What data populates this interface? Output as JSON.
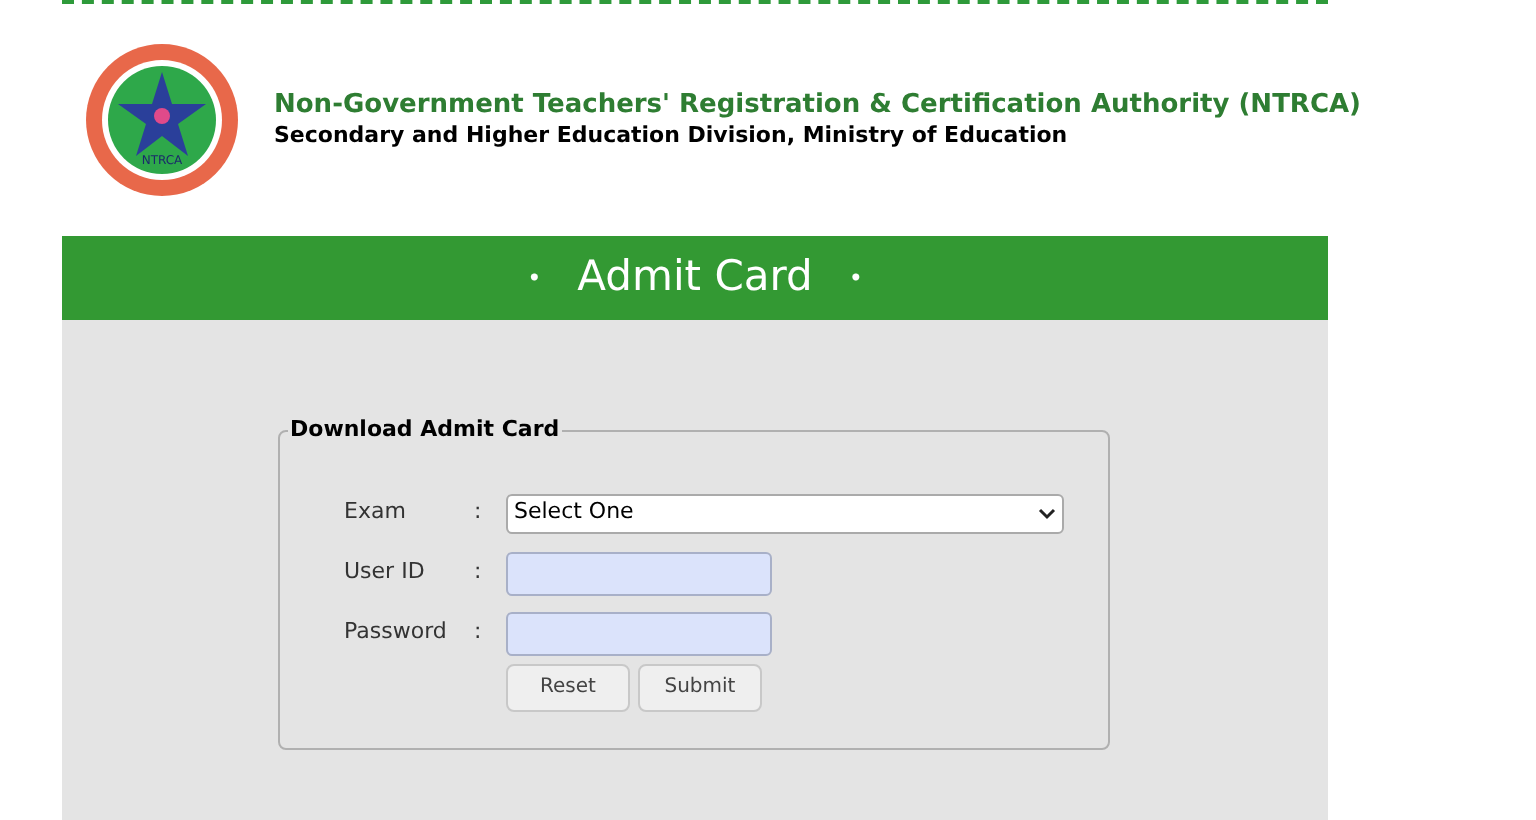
{
  "header": {
    "logo_text": "NTRCA",
    "title": "Non-Government Teachers' Registration & Certification Authority (NTRCA)",
    "subtitle": "Secondary and Higher Education Division, Ministry of Education"
  },
  "banner": {
    "bullet_left": "•",
    "title": "Admit Card",
    "bullet_right": "•"
  },
  "form": {
    "legend": "Download Admit Card",
    "fields": [
      {
        "kind": "select",
        "label": "Exam",
        "separator": ":",
        "value": "Select One"
      },
      {
        "kind": "text",
        "label": "User ID",
        "separator": ":"
      },
      {
        "kind": "password",
        "label": "Password",
        "separator": ":"
      }
    ],
    "buttons": [
      "Reset",
      "Submit"
    ]
  }
}
